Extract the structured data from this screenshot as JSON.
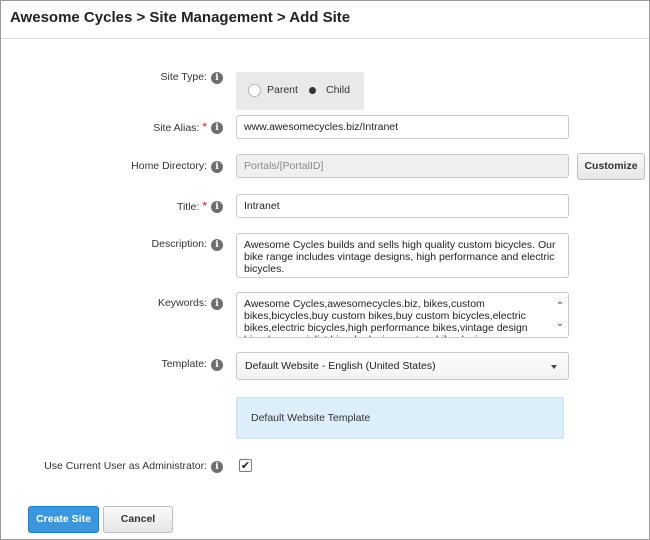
{
  "header": {
    "title": "Awesome Cycles > Site Management > Add Site"
  },
  "form": {
    "site_type": {
      "label": "Site Type:",
      "options": [
        "Parent",
        "Child"
      ],
      "selected": "Child"
    },
    "site_alias": {
      "label": "Site Alias:",
      "required_marker": "*",
      "value": "www.awesomecycles.biz/Intranet"
    },
    "home_directory": {
      "label": "Home Directory:",
      "value": "Portals/[PortalID]",
      "customize_label": "Customize"
    },
    "title": {
      "label": "Title:",
      "required_marker": "*",
      "value": "Intranet"
    },
    "description": {
      "label": "Description:",
      "value": "Awesome Cycles builds and sells high quality custom bicycles. Our bike range includes vintage designs, high performance and electric bicycles."
    },
    "keywords": {
      "label": "Keywords:",
      "value": "Awesome Cycles,awesomecycles.biz, bikes,custom bikes,bicycles,buy custom bikes,buy custom bicycles,electric bikes,electric bicycles,high performance bikes,vintage design bicycles,specialist bicycle design,custom bike design"
    },
    "template": {
      "label": "Template:",
      "value": "Default Website - English (United States)",
      "info_text": "Default Website Template"
    },
    "use_current_user": {
      "label": "Use Current User as Administrator:",
      "checked": true,
      "check_glyph": "✔"
    }
  },
  "actions": {
    "create_label": "Create Site",
    "cancel_label": "Cancel"
  },
  "icons": {
    "info_glyph": "i",
    "scroll_up_glyph": "⌃",
    "scroll_down_glyph": "⌄"
  },
  "colors": {
    "primary_button": "#3a97dd",
    "required": "#e01e1e",
    "template_info_bg": "#dbeefa"
  }
}
